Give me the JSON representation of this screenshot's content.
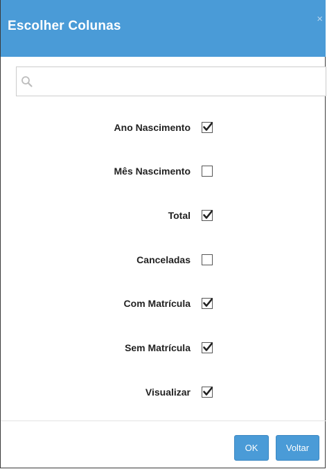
{
  "dialog": {
    "title": "Escolher Colunas",
    "close_glyph": "×"
  },
  "search": {
    "placeholder": "",
    "value": "",
    "icon": "search-icon"
  },
  "columns": [
    {
      "label": "Ano Nascimento",
      "checked": true
    },
    {
      "label": "Mês Nascimento",
      "checked": false
    },
    {
      "label": "Total",
      "checked": true
    },
    {
      "label": "Canceladas",
      "checked": false
    },
    {
      "label": "Com Matrícula",
      "checked": true
    },
    {
      "label": "Sem Matrícula",
      "checked": true
    },
    {
      "label": "Visualizar",
      "checked": true
    }
  ],
  "footer": {
    "ok_label": "OK",
    "back_label": "Voltar"
  },
  "colors": {
    "header": "#4a9bd7",
    "button": "#4a9bd7"
  }
}
